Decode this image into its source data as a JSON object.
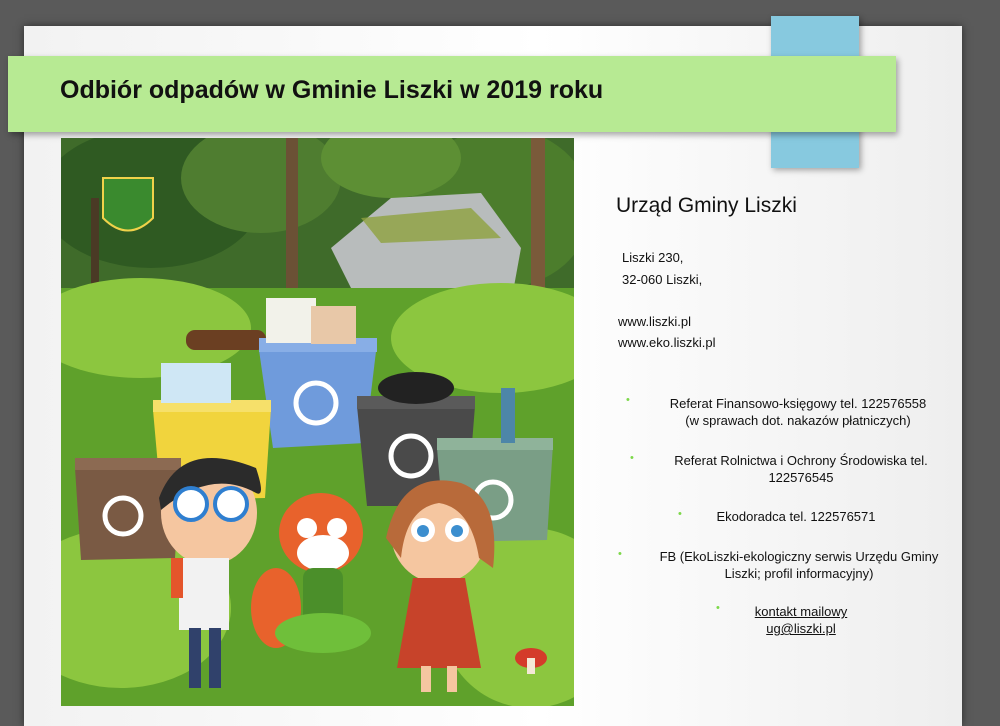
{
  "title": "Odbiór odpadów w Gminie Liszki w 2019 roku",
  "office": {
    "name": "Urząd Gminy Liszki",
    "address_line1": "Liszki 230,",
    "address_line2": "32-060 Liszki,",
    "website1": "www.liszki.pl",
    "website2": "www.eko.liszki.pl"
  },
  "contacts": [
    {
      "line1": "Referat Finansowo-księgowy tel. 122576558",
      "line2": "(w sprawach dot. nakazów płatniczych)"
    },
    {
      "line1": "Referat Rolnictwa i Ochrony Środowiska tel.",
      "line2": "122576545"
    },
    {
      "line1": "Ekodoradca tel. 122576571",
      "line2": ""
    },
    {
      "line1": "FB (EkoLiszki-ekologiczny serwis Urzędu Gminy",
      "line2": "Liszki; profil informacyjny)"
    },
    {
      "line1": "kontakt mailowy",
      "line2": "ug@liszki.pl"
    }
  ],
  "colors": {
    "banner": "#b7ea93",
    "accent_tab": "#87c9df",
    "bullet": "#7dd84a"
  }
}
